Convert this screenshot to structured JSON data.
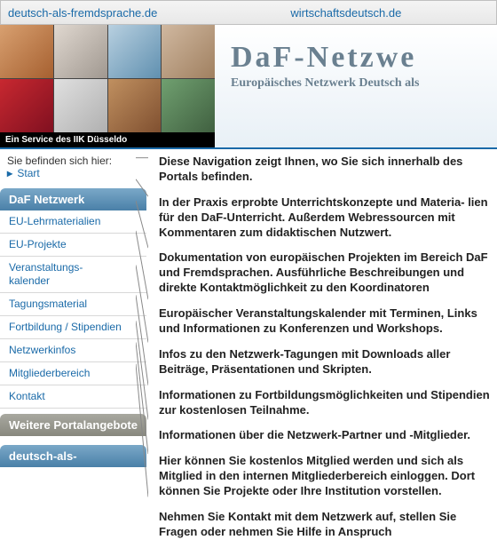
{
  "topbar": {
    "link1": "deutsch-als-fremdsprache.de",
    "link2": "wirtschaftsdeutsch.de"
  },
  "header": {
    "service_line": "Ein Service des IIK Düsseldo",
    "brand": "DaF-Netzwe",
    "tagline": "Europäisches Netzwerk Deutsch als"
  },
  "breadcrumb": {
    "label": "Sie befinden sich hier:",
    "start": "Start"
  },
  "nav": {
    "header1": "DaF Netzwerk",
    "items": [
      "EU-Lehrmaterialien",
      "EU-Projekte",
      "Veranstaltungs-\nkalender",
      "Tagungsmaterial",
      "Fortbildung / Stipendien",
      "Netzwerkinfos",
      "Mitgliederbereich",
      "Kontakt"
    ],
    "header2": "Weitere Portalangebote",
    "header3": "deutsch-als-"
  },
  "descriptions": [
    "Diese Navigation zeigt Ihnen, wo Sie sich innerhalb des Portals befinden.",
    "In der Praxis erprobte Unterrichtskonzepte und Materia- lien für den DaF-Unterricht. Außerdem Webressourcen mit Kommentaren zum didaktischen Nutzwert.",
    "Dokumentation von europäischen Projekten im Bereich DaF und Fremdsprachen. Ausführliche Beschreibungen und direkte Kontaktmöglichkeit zu den Koordinatoren",
    "Europäischer Veranstaltungskalender mit Terminen, Links und Informationen zu Konferenzen und Workshops.",
    "Infos zu den Netzwerk-Tagungen mit Downloads aller Beiträge, Präsentationen und Skripten.",
    "Informationen zu Fortbildungsmöglichkeiten und Stipendien zur kostenlosen Teilnahme.",
    "Informationen über die Netzwerk-Partner und -Mitglieder.",
    "Hier können Sie kostenlos Mitglied werden und sich als Mitglied in den internen Mitgliederbereich einloggen. Dort können Sie Projekte oder Ihre Institution vorstellen.",
    "Nehmen Sie Kontakt mit dem Netzwerk auf, stellen Sie Fragen oder nehmen Sie Hilfe in Anspruch"
  ]
}
